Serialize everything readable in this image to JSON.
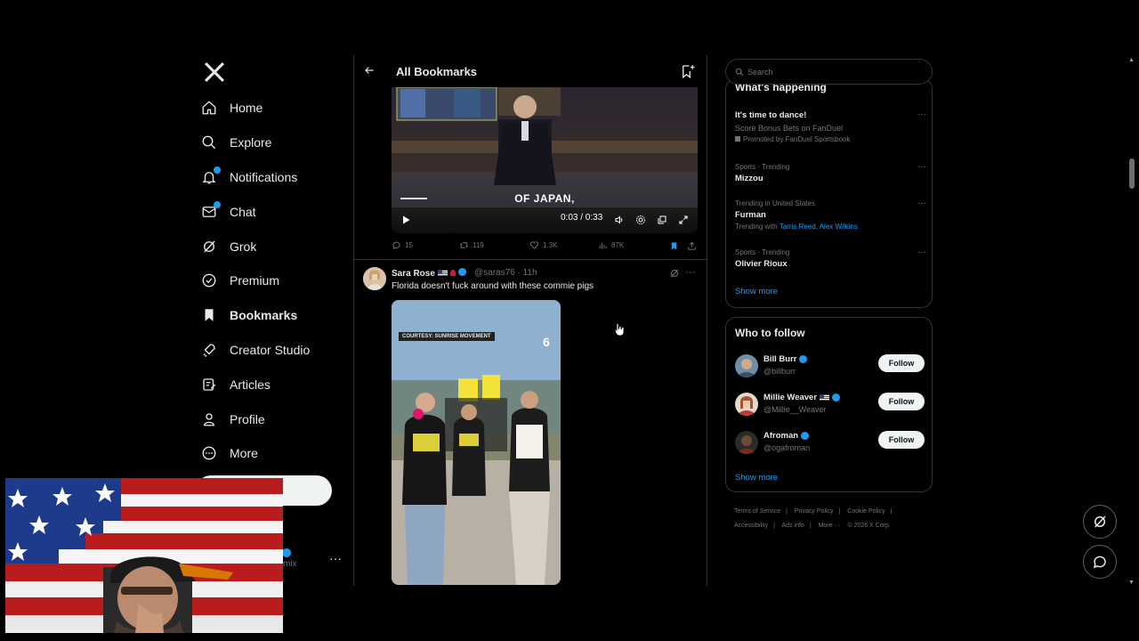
{
  "nav": {
    "logo": "X",
    "items": [
      {
        "label": "Home",
        "icon": "home-icon"
      },
      {
        "label": "Explore",
        "icon": "search-icon"
      },
      {
        "label": "Notifications",
        "icon": "bell-icon"
      },
      {
        "label": "Chat",
        "icon": "mail-icon"
      },
      {
        "label": "Grok",
        "icon": "grok-icon"
      },
      {
        "label": "Premium",
        "icon": "premium-icon"
      },
      {
        "label": "Bookmarks",
        "icon": "bookmark-icon"
      },
      {
        "label": "Creator Studio",
        "icon": "rocket-icon"
      },
      {
        "label": "Articles",
        "icon": "article-icon"
      },
      {
        "label": "Profile",
        "icon": "person-icon"
      },
      {
        "label": "More",
        "icon": "more-circle-icon"
      }
    ],
    "account_handle": "mix",
    "account_more": "···"
  },
  "main": {
    "title": "All Bookmarks",
    "video1": {
      "caption": "OF JAPAN,",
      "time": "0:03 / 0:33"
    },
    "actions1": {
      "replies": "15",
      "reposts": "119",
      "likes": "1.3K",
      "views": "87K"
    },
    "tweet2": {
      "name": "Sara Rose",
      "handle": "@saras76 · 11h",
      "text": "Florida doesn't fuck around with these commie pigs",
      "video_tag": "COURTESY: SUNRISE MOVEMENT",
      "more": "···"
    }
  },
  "right": {
    "search_placeholder": "Search",
    "trending_title": "What's happening",
    "trends": [
      {
        "meta": "",
        "name": "It's time to dance!",
        "sub": "Score Bonus Bets on FanDuel",
        "promo": "Promoted by FanDuel Sportsbook"
      },
      {
        "meta": "Sports · Trending",
        "name": "Mizzou"
      },
      {
        "meta": "Trending in United States",
        "name": "Furman",
        "with_label": "Trending with",
        "with_names": "Tarris Reed, Alex Wilkins"
      },
      {
        "meta": "Sports · Trending",
        "name": "Olivier Rioux"
      }
    ],
    "trend_show_more": "Show more",
    "who_title": "Who to follow",
    "who": [
      {
        "name": "Bill Burr",
        "handle": "@billburr",
        "button": "Follow"
      },
      {
        "name": "Millie Weaver",
        "handle": "@Millie__Weaver",
        "button": "Follow"
      },
      {
        "name": "Afroman",
        "handle": "@ogafroman",
        "button": "Follow"
      }
    ],
    "who_show_more": "Show more",
    "footer": [
      "Terms of Service",
      "|",
      "Privacy Policy",
      "|",
      "Cookie Policy",
      "|",
      "Accessibility",
      "|",
      "Ads info",
      "|",
      "More ···",
      "© 2026 X Corp."
    ]
  },
  "colors": {
    "accent": "#1d9bf0",
    "background": "#000000",
    "border": "#2f3336",
    "muted": "#71767b"
  }
}
